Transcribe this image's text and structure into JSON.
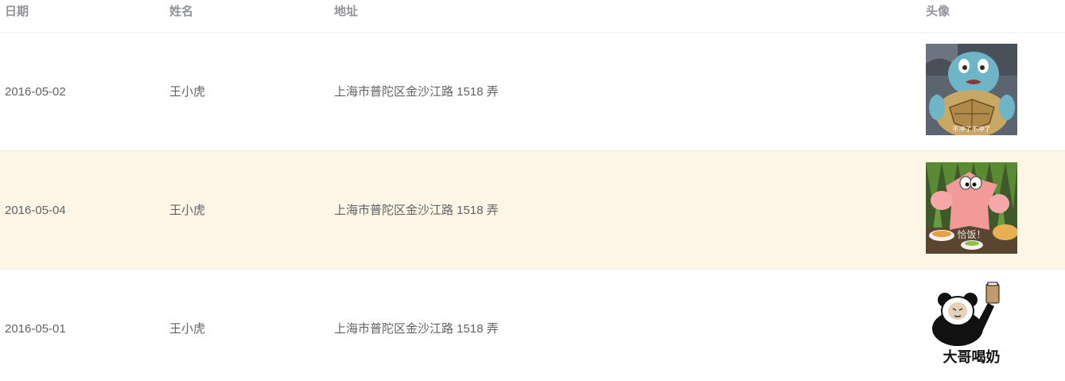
{
  "table": {
    "headers": {
      "date": "日期",
      "name": "姓名",
      "address": "地址",
      "avatar": "头像"
    },
    "rows": [
      {
        "date": "2016-05-02",
        "name": "王小虎",
        "address": "上海市普陀区金沙江路 1518 弄",
        "avatar_icon": "squirtle-meme-image",
        "avatar_caption": "不冲了不冲了"
      },
      {
        "date": "2016-05-04",
        "name": "王小虎",
        "address": "上海市普陀区金沙江路 1518 弄",
        "avatar_icon": "patrick-star-meme-image",
        "avatar_caption": "恰饭！"
      },
      {
        "date": "2016-05-01",
        "name": "王小虎",
        "address": "上海市普陀区金沙江路 1518 弄",
        "avatar_icon": "panda-meme-image",
        "avatar_caption": "大哥喝奶"
      }
    ],
    "colors": {
      "header_text": "#909399",
      "cell_text": "#606266",
      "stripe_bg": "#fdf5e6",
      "border": "#ebeef5"
    }
  }
}
